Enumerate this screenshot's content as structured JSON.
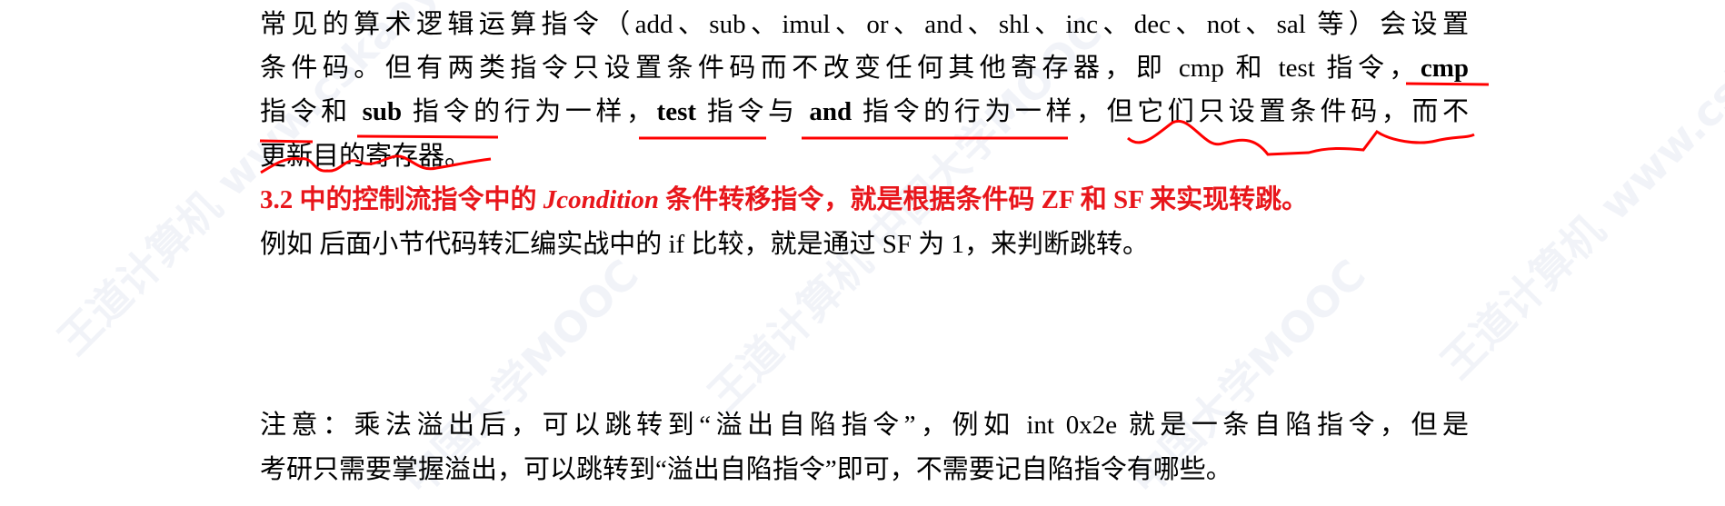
{
  "paragraph1": {
    "line1": "常见的算术逻辑运算指令（add、sub、imul、or、and、shl、inc、dec、not、sal 等）会设置",
    "line2_a": "条件码。但有两类指令只设置条件码而不改变任何其他寄存器，即 cmp 和 test 指令，",
    "line2_b": "cmp",
    "line3_a": "指令和 ",
    "line3_b": "sub",
    "line3_c": " 指令的行为一样，",
    "line3_d": "test",
    "line3_e": " 指令与 ",
    "line3_f": "and",
    "line3_g": " 指令的行为一样，但它们只设置条件码，而不",
    "line4": "更新目的寄存器。"
  },
  "paragraph2": {
    "a": "3.2 中的控制流指令中的 ",
    "b": "Jcondition",
    "c": " 条件转移指令，就是根据条件码 ZF 和 SF 来实现转跳。"
  },
  "paragraph3": "例如  后面小节代码转汇编实战中的 if 比较，就是通过 SF 为 1，来判断跳转。",
  "note": {
    "line1": "注意：乘法溢出后，可以跳转到“溢出自陷指令”，例如 int 0x2e 就是一条自陷指令，但是",
    "line2": "考研只需要掌握溢出，可以跳转到“溢出自陷指令”即可，不需要记自陷指令有哪些。"
  },
  "colors": {
    "highlight": "#e8161b",
    "annotation": "#ff0000"
  }
}
